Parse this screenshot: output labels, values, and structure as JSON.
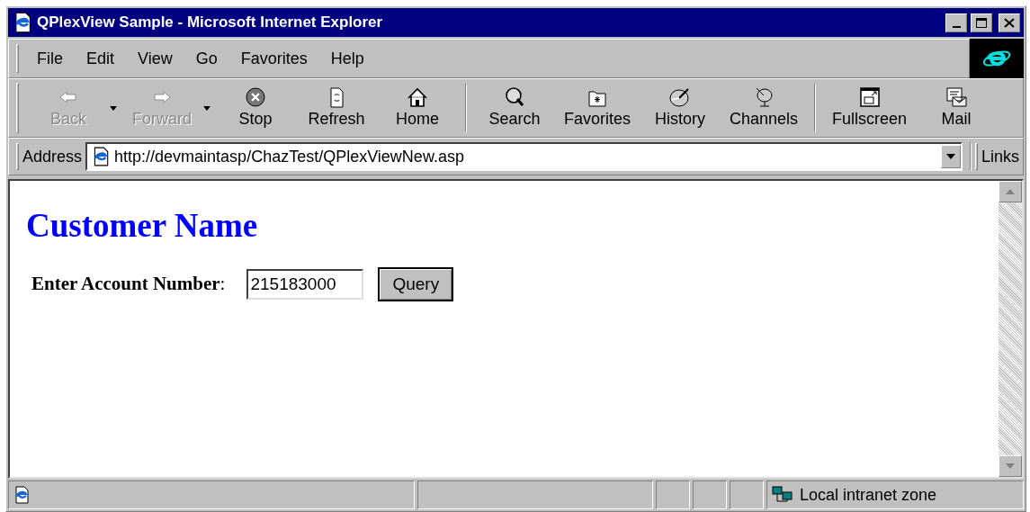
{
  "window": {
    "title": "QPlexView Sample - Microsoft Internet Explorer"
  },
  "menu": [
    "File",
    "Edit",
    "View",
    "Go",
    "Favorites",
    "Help"
  ],
  "toolbar_groups": [
    [
      {
        "kind": "back",
        "label": "Back",
        "disabled": true,
        "dropdown": true
      },
      {
        "kind": "forward",
        "label": "Forward",
        "disabled": true,
        "dropdown": true
      },
      {
        "kind": "stop",
        "label": "Stop",
        "disabled": false,
        "dropdown": false
      },
      {
        "kind": "refresh",
        "label": "Refresh",
        "disabled": false,
        "dropdown": false
      },
      {
        "kind": "home",
        "label": "Home",
        "disabled": false,
        "dropdown": false
      }
    ],
    [
      {
        "kind": "search",
        "label": "Search",
        "disabled": false,
        "dropdown": false
      },
      {
        "kind": "favorites",
        "label": "Favorites",
        "disabled": false,
        "dropdown": false
      },
      {
        "kind": "history",
        "label": "History",
        "disabled": false,
        "dropdown": false
      },
      {
        "kind": "channels",
        "label": "Channels",
        "disabled": false,
        "dropdown": false
      }
    ],
    [
      {
        "kind": "fullscreen",
        "label": "Fullscreen",
        "disabled": false,
        "dropdown": false
      },
      {
        "kind": "mail",
        "label": "Mail",
        "disabled": false,
        "dropdown": false
      }
    ]
  ],
  "address": {
    "label": "Address",
    "value": "http://devmaintasp/ChazTest/QPlexViewNew.asp"
  },
  "links": "Links",
  "page": {
    "heading": "Customer Name",
    "field_label": "Enter Account Number",
    "field_suffix": ":",
    "field_value": "215183000",
    "button": "Query"
  },
  "status_bar": {
    "zone": "Local intranet zone"
  }
}
